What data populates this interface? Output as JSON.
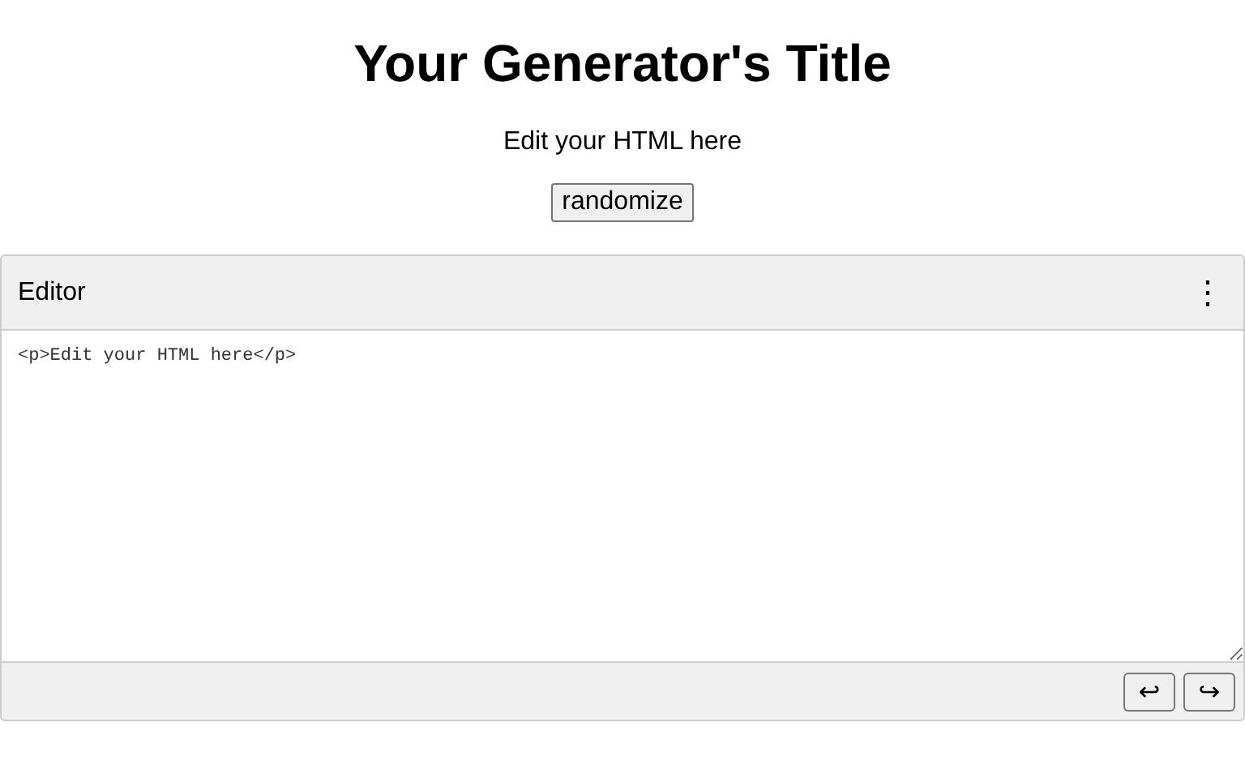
{
  "title": "Your Generator's Title",
  "preview_text": "Edit your HTML here",
  "randomize_button": "randomize",
  "editor": {
    "title": "Editor",
    "menu_icon": "⋮",
    "code": "<p>Edit your HTML here</p>",
    "buttons": [
      "↩",
      "↪"
    ]
  }
}
